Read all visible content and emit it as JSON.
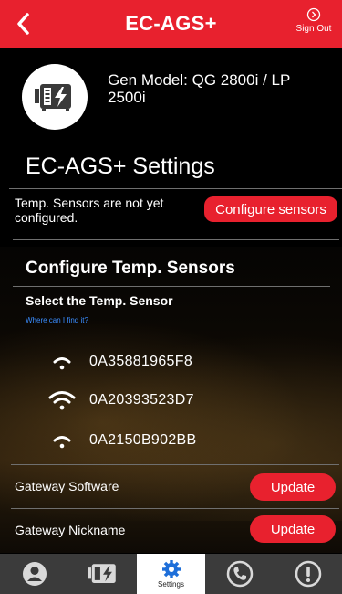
{
  "colors": {
    "accent": "#e8212e",
    "background": "#000000",
    "tabbar": "#3b3b3b",
    "link": "#3a8dff"
  },
  "header": {
    "title": "EC-AGS+",
    "back_icon": "chevron-left-icon",
    "signout_icon": "signout-circle-icon",
    "signout_label": "Sign Out"
  },
  "generator": {
    "icon": "generator-icon",
    "model": "Gen Model: QG 2800i / LP 2500i"
  },
  "settings": {
    "title": "EC-AGS+ Settings",
    "sensors_note": "Temp. Sensors are not yet configured.",
    "configure_button": "Configure sensors",
    "configure_section_title": "Configure Temp. Sensors",
    "select_label": "Select the Temp. Sensor",
    "where_link": "Where can I find it?",
    "sensors": [
      {
        "id": "0A35881965F8",
        "signal": "medium"
      },
      {
        "id": "0A20393523D7",
        "signal": "strong"
      },
      {
        "id": "0A2150B902BB",
        "signal": "medium"
      }
    ],
    "gateway_software_label": "Gateway Software",
    "gateway_software_button": "Update",
    "gateway_nickname_label": "Gateway Nickname",
    "gateway_nickname_button": "Update"
  },
  "tabbar": {
    "tabs": [
      {
        "icon": "user-icon",
        "label": "",
        "active": false
      },
      {
        "icon": "generator-icon",
        "label": "",
        "active": false
      },
      {
        "icon": "gear-icon",
        "label": "Settings",
        "active": true
      },
      {
        "icon": "phone-icon",
        "label": "",
        "active": false
      },
      {
        "icon": "alert-icon",
        "label": "",
        "active": false
      }
    ]
  }
}
